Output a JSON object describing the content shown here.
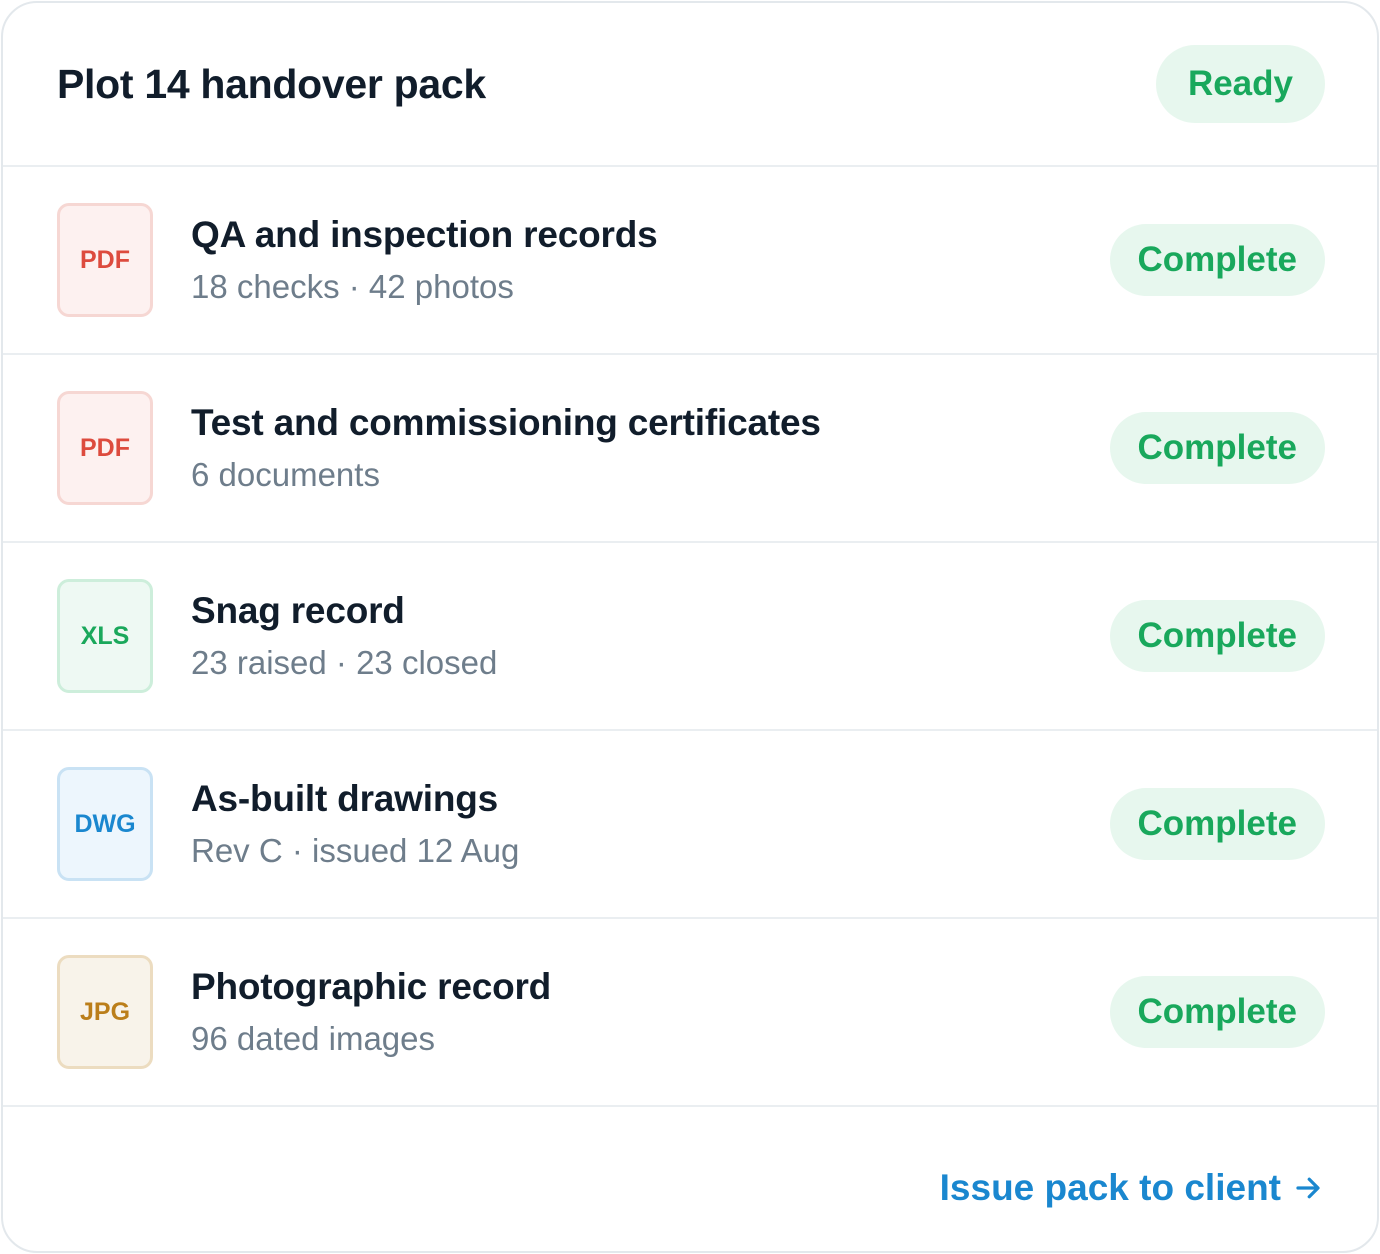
{
  "header": {
    "title": "Plot 14 handover pack",
    "status": "Ready"
  },
  "items": [
    {
      "file_type": "PDF",
      "title": "QA and inspection records",
      "subtitle": "18 checks · 42 photos",
      "status": "Complete"
    },
    {
      "file_type": "PDF",
      "title": "Test and commissioning certificates",
      "subtitle": "6 documents",
      "status": "Complete"
    },
    {
      "file_type": "XLS",
      "title": "Snag record",
      "subtitle": "23 raised · 23 closed",
      "status": "Complete"
    },
    {
      "file_type": "DWG",
      "title": "As-built drawings",
      "subtitle": "Rev C · issued 12 Aug",
      "status": "Complete"
    },
    {
      "file_type": "JPG",
      "title": "Photographic record",
      "subtitle": "96 dated images",
      "status": "Complete"
    }
  ],
  "footer": {
    "action_label": "Issue pack to client",
    "action_icon": "arrow-right-icon"
  },
  "colors": {
    "success": "#19a85c",
    "success_bg": "#e7f7ee",
    "link": "#1a87cf",
    "pdf": "#dd4b3e",
    "xls": "#1aa85b",
    "dwg": "#1a87cf",
    "jpg": "#bb7e1a"
  }
}
